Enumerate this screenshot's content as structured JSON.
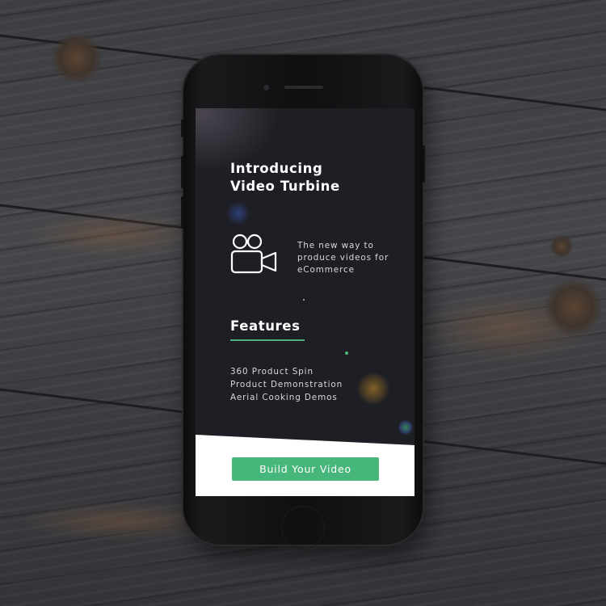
{
  "hero": {
    "title_line1": "Introducing",
    "title_line2": "Video Turbine",
    "tagline_lines": [
      "The new way to",
      "produce videos for",
      "eCommerce"
    ]
  },
  "features": {
    "heading": "Features",
    "items": [
      "360 Product Spin",
      "Product Demonstration",
      "Aerial Cooking Demos"
    ]
  },
  "cta": {
    "label": "Build Your Video"
  },
  "icons": {
    "hero_icon": "video-camera-icon"
  },
  "colors": {
    "screen_background": "#1e1f24",
    "accent_green": "#47b67a",
    "underline_green": "#4aae7e",
    "text_primary": "#ffffff",
    "text_secondary": "#d8d8dc"
  }
}
